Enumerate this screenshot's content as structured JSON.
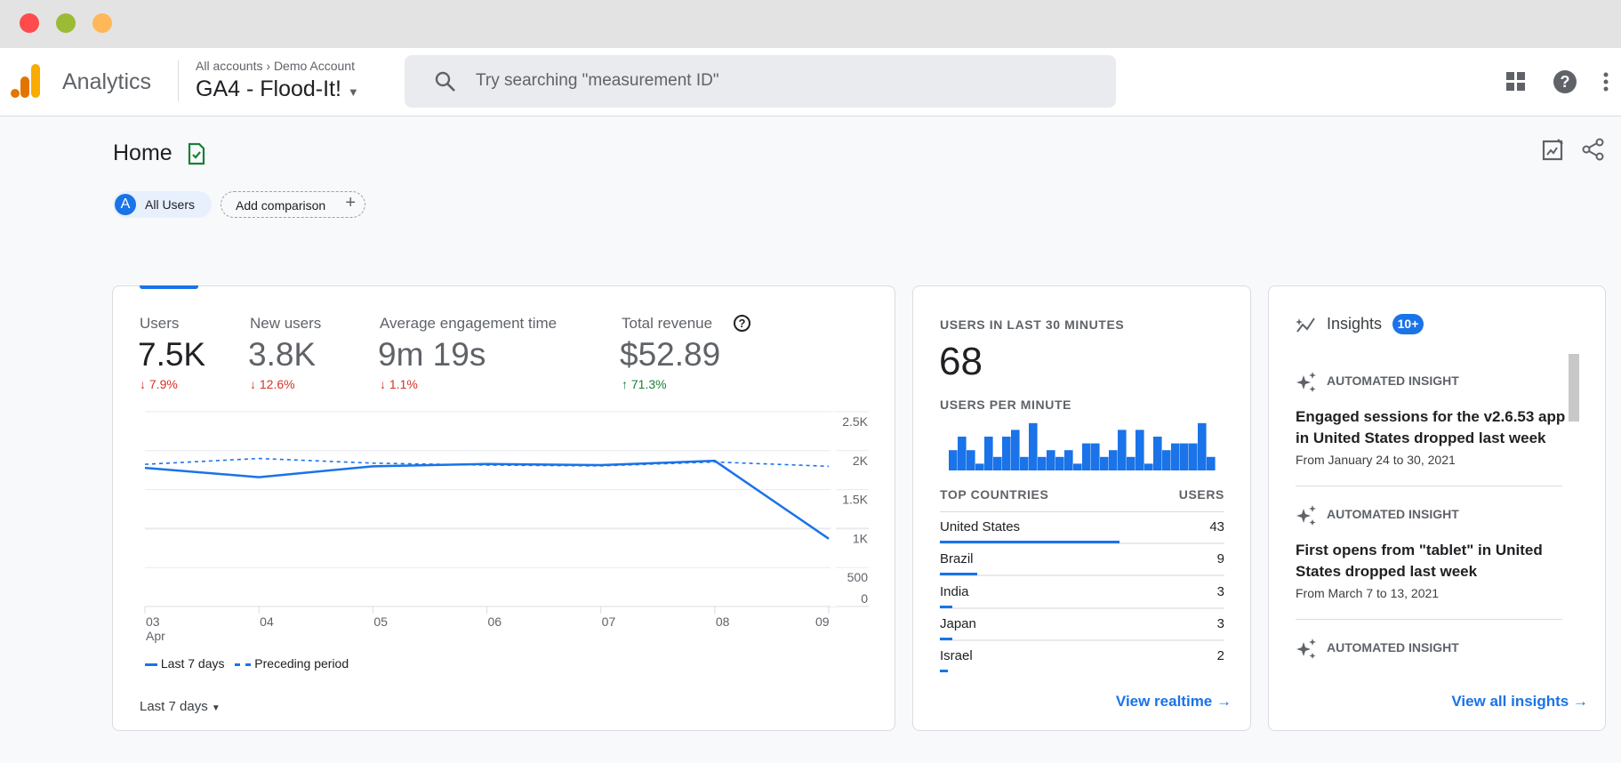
{
  "window": {
    "controls": [
      "close",
      "minimize",
      "maximize"
    ]
  },
  "header": {
    "app_name": "Analytics",
    "breadcrumb": [
      "All accounts",
      "Demo Account"
    ],
    "property": "GA4 - Flood-It!",
    "search_placeholder": "Try searching \"measurement ID\""
  },
  "page": {
    "title": "Home",
    "chips": {
      "segment_letter": "A",
      "segment": "All Users",
      "add_comparison": "Add comparison"
    }
  },
  "overview": {
    "metrics": [
      {
        "label": "Users",
        "value": "7.5K",
        "delta": "7.9%",
        "direction": "down"
      },
      {
        "label": "New users",
        "value": "3.8K",
        "delta": "12.6%",
        "direction": "down"
      },
      {
        "label": "Average engagement time",
        "value": "9m 19s",
        "delta": "1.1%",
        "direction": "down"
      },
      {
        "label": "Total revenue",
        "value": "$52.89",
        "delta": "71.3%",
        "direction": "up"
      }
    ],
    "date_range": "Last 7 days"
  },
  "chart_data": [
    {
      "type": "line",
      "categories": [
        "03",
        "04",
        "05",
        "06",
        "07",
        "08",
        "09"
      ],
      "x_sublabel": "Apr",
      "yticks": [
        "0",
        "500",
        "1K",
        "1.5K",
        "2K",
        "2.5K"
      ],
      "ylim": [
        0,
        2500
      ],
      "grid": true,
      "legend_position": "bottom-left",
      "series": [
        {
          "name": "Last 7 days",
          "style": "solid",
          "values": [
            1780,
            1660,
            1800,
            1830,
            1815,
            1870,
            870
          ]
        },
        {
          "name": "Preceding period",
          "style": "dashed",
          "values": [
            1825,
            1900,
            1840,
            1815,
            1805,
            1855,
            1800
          ]
        }
      ],
      "color": "#1a73e8"
    },
    {
      "type": "bar",
      "title": "USERS PER MINUTE",
      "values": [
        3,
        5,
        3,
        1,
        5,
        2,
        5,
        6,
        2,
        7,
        2,
        3,
        2,
        3,
        1,
        4,
        4,
        2,
        3,
        6,
        2,
        6,
        1,
        5,
        3,
        4,
        4,
        4,
        7,
        2
      ],
      "color": "#1a73e8"
    }
  ],
  "realtime": {
    "title": "USERS IN LAST 30 MINUTES",
    "value": "68",
    "per_minute": "USERS PER MINUTE",
    "col_country": "TOP COUNTRIES",
    "col_users": "USERS",
    "countries": [
      {
        "name": "United States",
        "users": "43",
        "n": 43
      },
      {
        "name": "Brazil",
        "users": "9",
        "n": 9
      },
      {
        "name": "India",
        "users": "3",
        "n": 3
      },
      {
        "name": "Japan",
        "users": "3",
        "n": 3
      },
      {
        "name": "Israel",
        "users": "2",
        "n": 2
      }
    ],
    "link": "View realtime"
  },
  "insights": {
    "title": "Insights",
    "badge": "10+",
    "items": [
      {
        "tag": "AUTOMATED INSIGHT",
        "title": "Engaged sessions for the v2.6.53 app in United States dropped last week",
        "date": "From January 24 to 30, 2021"
      },
      {
        "tag": "AUTOMATED INSIGHT",
        "title": "First opens from \"tablet\" in United States dropped last week",
        "date": "From March 7 to 13, 2021"
      },
      {
        "tag": "AUTOMATED INSIGHT"
      }
    ],
    "link": "View all insights"
  },
  "colors": {
    "accent": "#1a73e8",
    "negative": "#d93025",
    "positive": "#188038"
  }
}
